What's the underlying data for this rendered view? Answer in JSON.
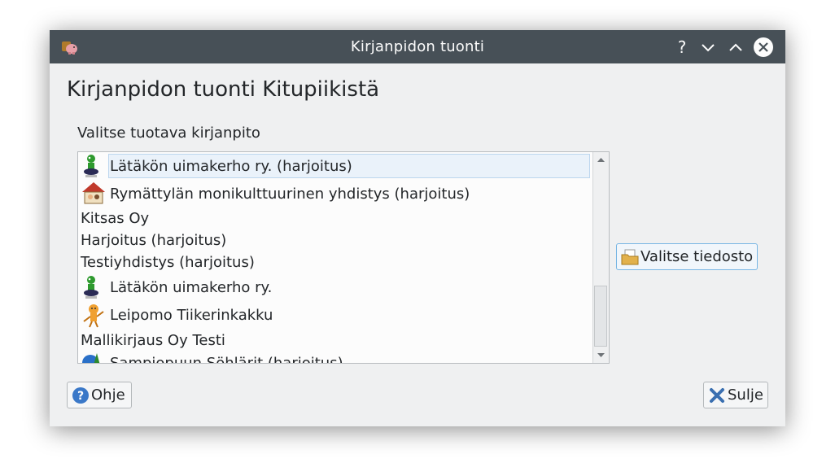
{
  "window": {
    "title": "Kirjanpidon tuonti",
    "help_glyph": "?",
    "app_icon": "piggy-bank-icon"
  },
  "dialog": {
    "heading": "Kirjanpidon tuonti Kitupiikistä",
    "list_label": "Valitse tuotava kirjanpito",
    "items": [
      {
        "label": "Lätäkön uimakerho ry. (harjoitus)",
        "icon": "frog-logo-icon",
        "selected": true
      },
      {
        "label": "Rymättylän monikulttuurinen yhdistys (harjoitus)",
        "icon": "house-logo-icon"
      },
      {
        "label": "Kitsas Oy",
        "icon": ""
      },
      {
        "label": "Harjoitus (harjoitus)",
        "icon": ""
      },
      {
        "label": "Testiyhdistys (harjoitus)",
        "icon": ""
      },
      {
        "label": "Lätäkön uimakerho ry.",
        "icon": "frog-logo-icon"
      },
      {
        "label": "Leipomo Tiikerinkakku",
        "icon": "tiger-logo-icon"
      },
      {
        "label": "Mallikirjaus Oy Testi",
        "icon": ""
      },
      {
        "label": "Sampiopuun Söhlärit (harjoitus)",
        "icon": "globe-logo-icon"
      }
    ],
    "choose_file_button": "Valitse tiedosto",
    "help_button": "Ohje",
    "close_button": "Sulje",
    "scroll_position": 0.78
  },
  "colors": {
    "titlebar": "#475057",
    "window_bg": "#eff0f1",
    "selection": "#eaf2fa",
    "focus_border": "#78b6e4"
  }
}
